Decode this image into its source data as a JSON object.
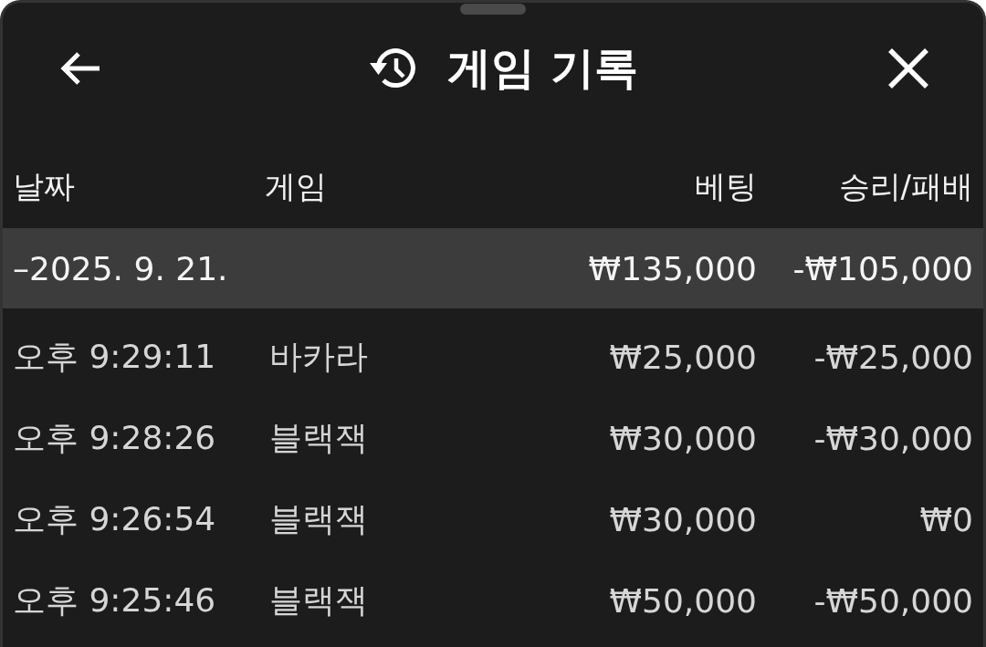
{
  "header": {
    "title": "게임 기록"
  },
  "table": {
    "columns": [
      "날짜",
      "게임",
      "베팅",
      "승리/패배"
    ],
    "groups": [
      {
        "date": "–2025. 9. 21.",
        "bet": "₩135,000",
        "result": "-₩105,000",
        "rows": [
          {
            "time": "오후 9:29:11",
            "game": "바카라",
            "bet": "₩25,000",
            "result": "-₩25,000"
          },
          {
            "time": "오후 9:28:26",
            "game": "블랙잭",
            "bet": "₩30,000",
            "result": "-₩30,000"
          },
          {
            "time": "오후 9:26:54",
            "game": "블랙잭",
            "bet": "₩30,000",
            "result": "₩0"
          },
          {
            "time": "오후 9:25:46",
            "game": "블랙잭",
            "bet": "₩50,000",
            "result": "-₩50,000"
          }
        ]
      }
    ]
  }
}
